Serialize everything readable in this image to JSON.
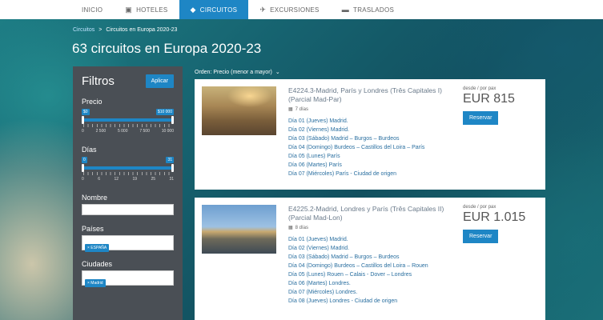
{
  "nav": {
    "items": [
      {
        "label": "INICIO",
        "icon": "",
        "active": false
      },
      {
        "label": "HOTELES",
        "icon": "suitcase-icon",
        "active": false
      },
      {
        "label": "CIRCUITOS",
        "icon": "tag-icon",
        "active": true
      },
      {
        "label": "EXCURSIONES",
        "icon": "plane-icon",
        "active": false
      },
      {
        "label": "TRASLADOS",
        "icon": "car-icon",
        "active": false
      }
    ]
  },
  "breadcrumb": {
    "link": "Circuitos",
    "separator": ">",
    "current": "Circuitos en Europa 2020-23"
  },
  "page_title": "63 circuitos en Europa 2020-23",
  "sort": {
    "label": "Orden: Precio (menor a mayor)",
    "icon": "chevron-down-icon"
  },
  "filters": {
    "title": "Filtros",
    "apply_label": "Aplicar",
    "price": {
      "label": "Precio",
      "min_badge": "$0",
      "max_badge": "$10 000",
      "min_value": 0,
      "max_value": 10000,
      "ticks": [
        "0",
        "2 500",
        "5 000",
        "7 500",
        "10 000"
      ]
    },
    "days": {
      "label": "Días",
      "min_badge": "0",
      "max_badge": "31",
      "min_value": 0,
      "max_value": 31,
      "ticks": [
        "0",
        "6",
        "12",
        "19",
        "25",
        "31"
      ]
    },
    "name_label": "Nombre",
    "countries_label": "Países",
    "country_chip": "× ESPAÑA",
    "cities_label": "Ciudades",
    "city_chip": "× Madrid"
  },
  "results": [
    {
      "title": "E4224.3-Madrid, París y Londres (Três Capitales I) (Parcial Mad-Par)",
      "days": "7 días",
      "itinerary": [
        "Día 01 (Jueves) Madrid.",
        "Día 02 (Viernes) Madrid.",
        "Día 03 (Sábado) Madrid – Burgos – Burdeos",
        "Día 04 (Domingo) Burdeos – Castillos del Loira – París",
        "Día 05 (Lunes) París",
        "Día 06 (Martes) París",
        "Día 07 (Miércoles) París - Ciudad de origen"
      ],
      "price_label": "desde / por pax",
      "price": "EUR 815",
      "reserve_label": "Reservar"
    },
    {
      "title": "E4225.2-Madrid, Londres y París (Três Capitales II) (Parcial Mad-Lon)",
      "days": "8 días",
      "itinerary": [
        "Día 01 (Jueves) Madrid.",
        "Día 02 (Viernes) Madrid.",
        "Día 03 (Sábado) Madrid – Burgos – Burdeos",
        "Día 04 (Domingo) Burdeos – Castillos del Loira – Rouen",
        "Día 05 (Lunes) Rouen – Calais - Dover – Londres",
        "Día 06 (Martes) Londres.",
        "Día 07 (Miércoles) Londres.",
        "Día 08 (Jueves) Londres - Ciudad de origen"
      ],
      "price_label": "desde / por pax",
      "price": "EUR 1.015",
      "reserve_label": "Reservar"
    }
  ],
  "colors": {
    "accent": "#1e86c5",
    "panel": "#4a4f55"
  }
}
